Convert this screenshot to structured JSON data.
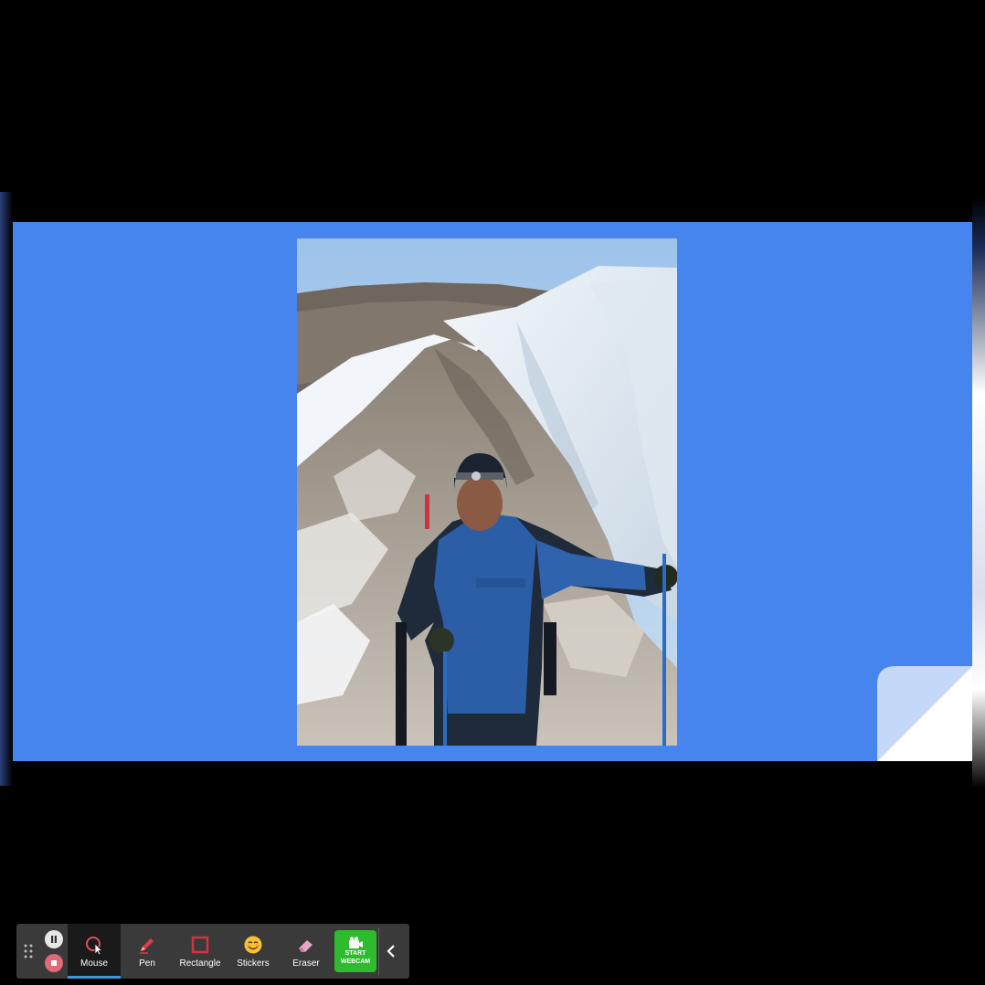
{
  "toolbar": {
    "tools": [
      {
        "id": "mouse",
        "label": "Mouse",
        "icon": "mouse-pointer-icon",
        "active": true
      },
      {
        "id": "pen",
        "label": "Pen",
        "icon": "pen-icon",
        "active": false
      },
      {
        "id": "rectangle",
        "label": "Rectangle",
        "icon": "rectangle-icon",
        "active": false
      },
      {
        "id": "stickers",
        "label": "Stickers",
        "icon": "sticker-smiley-icon",
        "active": false
      },
      {
        "id": "eraser",
        "label": "Eraser",
        "icon": "eraser-icon",
        "active": false
      }
    ],
    "webcam": {
      "line1": "START",
      "line2": "WEBCAM",
      "icon": "webcam-icon"
    },
    "controls": {
      "pause_icon": "pause-icon",
      "stop_icon": "stop-icon",
      "drag_icon": "drag-handle-icon",
      "collapse_icon": "chevron-left-icon"
    }
  },
  "slide": {
    "background_color": "#4785ee",
    "image": "photo-climber-on-glacier"
  },
  "colors": {
    "accent": "#3a9bd8",
    "webcam_green": "#2ebb2e",
    "stop_red": "#e06a78",
    "toolbar_bg": "#3a3a3a"
  }
}
